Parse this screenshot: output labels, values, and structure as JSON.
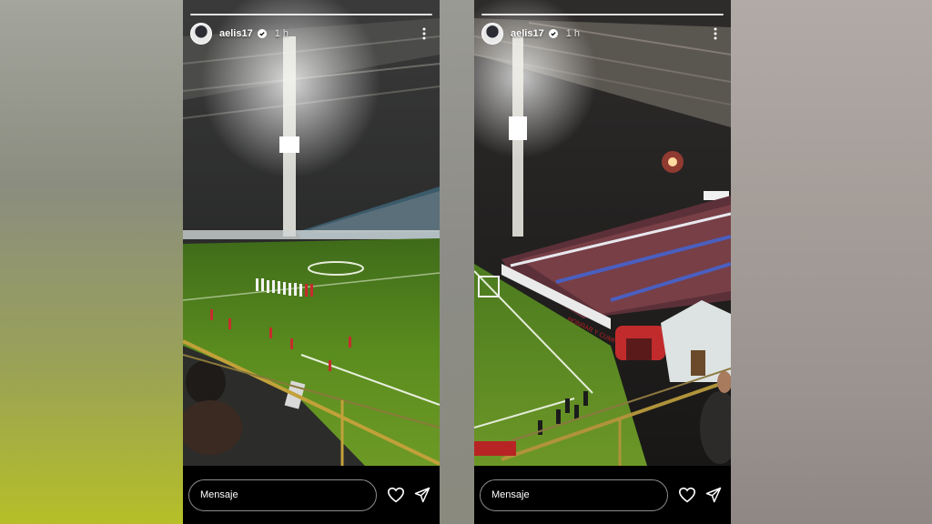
{
  "stories": [
    {
      "username": "aelis17",
      "timestamp": "1 h",
      "message_placeholder": "Mensaje",
      "photo_signage": "",
      "icons": [
        "avatar",
        "verified-badge-icon",
        "more-options-icon",
        "heart-icon",
        "send-icon"
      ]
    },
    {
      "username": "aelis17",
      "timestamp": "1 h",
      "message_placeholder": "Mensaje",
      "photo_signage": "HONRAR Y CUMPLIR",
      "icons": [
        "avatar",
        "verified-badge-icon",
        "more-options-icon",
        "heart-icon",
        "send-icon"
      ]
    }
  ],
  "colors": {
    "story_background": "#000000",
    "text": "#ffffff",
    "verified_badge": "#ffffff"
  }
}
